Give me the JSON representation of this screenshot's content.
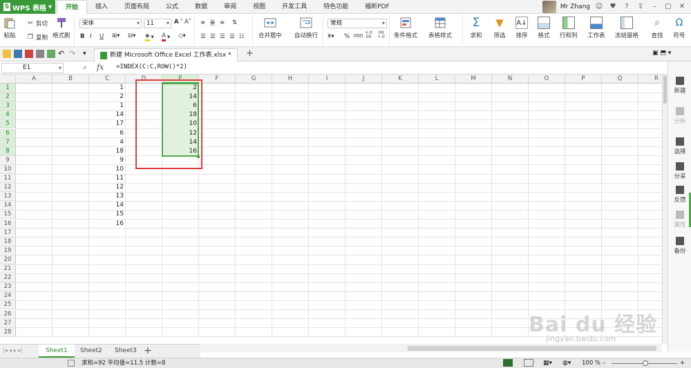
{
  "app": {
    "logo": "WPS 表格",
    "colors": {
      "brand": "#3a9a3a",
      "accent": "#e23b3b",
      "selection": "#4ea84a"
    }
  },
  "tabs": [
    "开始",
    "插入",
    "页面布局",
    "公式",
    "数据",
    "审阅",
    "视图",
    "开发工具",
    "特色功能",
    "福昕PDF"
  ],
  "user": {
    "name": "Mr Zhang"
  },
  "ribbon": {
    "paste": "粘贴",
    "cut": "剪切",
    "copy": "复制",
    "format_painter": "格式刷",
    "font_name": "宋体",
    "font_size": "11",
    "merge_center": "合并居中",
    "wrap": "自动换行",
    "number_format": "常规",
    "cond_format": "条件格式",
    "table_style": "表格样式",
    "sum": "求和",
    "filter": "筛选",
    "sort": "排序",
    "format": "格式",
    "rowcol": "行和列",
    "worksheet": "工作表",
    "freeze": "冻结窗格",
    "find": "查找",
    "symbol": "符号",
    "percent": "%",
    "comma": "000",
    "inc_decimal": "+.0 .00",
    "dec_decimal": ".00 +.0"
  },
  "document": {
    "tab_title": "新建 Microsoft Office Excel 工作表.xlsx *"
  },
  "formula_bar": {
    "name_box": "E1",
    "fx": "fx",
    "formula": "=INDEX(C:C,ROW()*2)"
  },
  "columns": [
    "A",
    "B",
    "C",
    "D",
    "E",
    "F",
    "G",
    "H",
    "I",
    "J",
    "K",
    "L",
    "M",
    "N",
    "O",
    "P",
    "Q",
    "R"
  ],
  "rows": [
    "1",
    "2",
    "3",
    "4",
    "5",
    "6",
    "7",
    "8",
    "9",
    "10",
    "11",
    "12",
    "13",
    "14",
    "15",
    "16",
    "17",
    "18",
    "19",
    "20",
    "21",
    "22",
    "23",
    "24",
    "25",
    "26",
    "27",
    "28"
  ],
  "column_c": [
    "1",
    "2",
    "1",
    "14",
    "17",
    "6",
    "4",
    "18",
    "9",
    "10",
    "11",
    "12",
    "13",
    "14",
    "15",
    "16"
  ],
  "column_e": [
    "2",
    "14",
    "6",
    "18",
    "10",
    "12",
    "14",
    "16"
  ],
  "sheets": [
    "Sheet1",
    "Sheet2",
    "Sheet3"
  ],
  "sidebar": [
    "新建",
    "分析",
    "选择",
    "分享",
    "反馈",
    "属性",
    "备份"
  ],
  "status": {
    "summary": "求和=92  平均值=11.5  计数=8",
    "zoom": "100 %"
  },
  "watermark": {
    "main": "Bai du 经验",
    "sub": "jingyan.baidu.com"
  }
}
